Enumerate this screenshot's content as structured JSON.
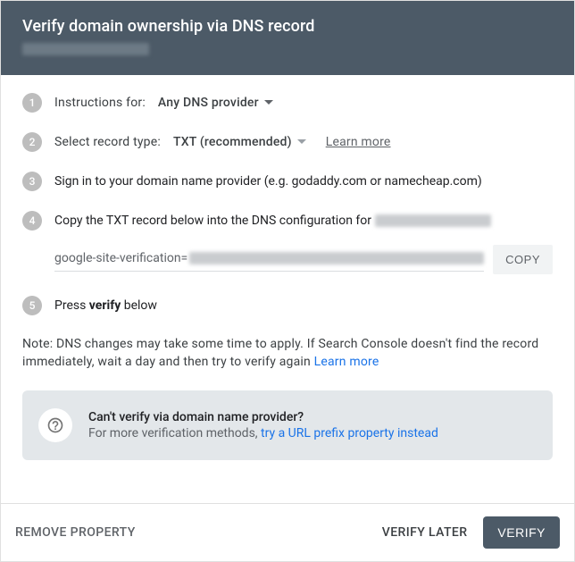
{
  "header": {
    "title": "Verify domain ownership via DNS record"
  },
  "steps": {
    "s1": {
      "num": "1",
      "label": "Instructions for:",
      "dropdown": "Any DNS provider"
    },
    "s2": {
      "num": "2",
      "label": "Select record type:",
      "dropdown": "TXT (recommended)",
      "learn_more": "Learn more"
    },
    "s3": {
      "num": "3",
      "text": "Sign in to your domain name provider (e.g. godaddy.com or namecheap.com)"
    },
    "s4": {
      "num": "4",
      "text": "Copy the TXT record below into the DNS configuration for "
    },
    "s5": {
      "num": "5",
      "prefix": "Press ",
      "bold": "verify",
      "suffix": " below"
    }
  },
  "record": {
    "prefix": "google-site-verification=",
    "copy": "COPY"
  },
  "note": {
    "text": "Note: DNS changes may take some time to apply. If Search Console doesn't find the record immediately, wait a day and then try to verify again ",
    "learn_more": "Learn more"
  },
  "alt": {
    "title": "Can't verify via domain name provider?",
    "text": "For more verification methods, ",
    "link": "try a URL prefix property instead"
  },
  "footer": {
    "remove": "REMOVE PROPERTY",
    "later": "VERIFY LATER",
    "verify": "VERIFY"
  }
}
